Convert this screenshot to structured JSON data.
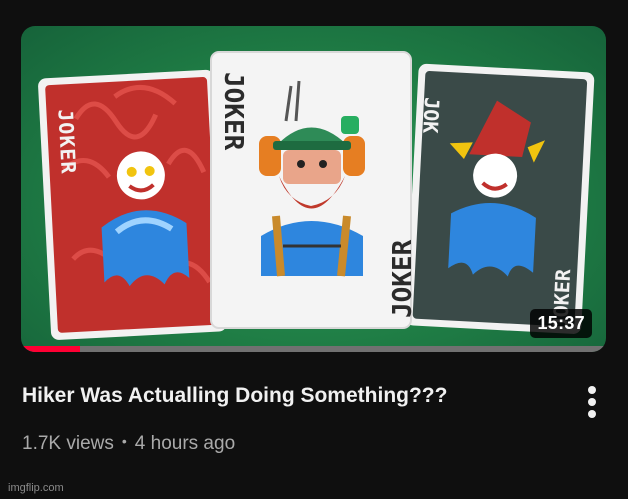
{
  "video": {
    "title": "Hiker Was Actualling Doing Something???",
    "views": "1.7K views",
    "age": "4 hours ago",
    "separator": "•",
    "duration": "15:37",
    "watch_progress": 0.1
  },
  "thumbnail": {
    "card_lettering": "JOKER"
  },
  "watermark": "imgflip.com",
  "icons": {
    "menu": "kebab-vertical-icon"
  },
  "colors": {
    "background": "#0f0f0f",
    "felt": "#1f7d45",
    "progress": "#ff0033",
    "title": "#f1f1f1",
    "meta": "#aaaaaa"
  }
}
